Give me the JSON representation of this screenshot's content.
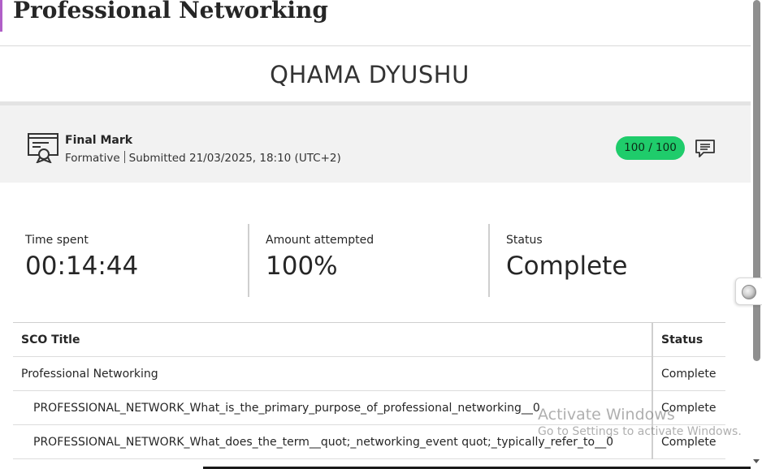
{
  "page": {
    "title": "Professional Networking",
    "accent_color": "#b05fc7"
  },
  "student": {
    "name": "QHAMA DYUSHU"
  },
  "final_mark": {
    "icon": "certificate-icon",
    "label": "Final Mark",
    "type": "Formative",
    "submitted": "Submitted 21/03/2025, 18:10 (UTC+2)",
    "score": "100 / 100",
    "score_color": "#1fcc6b",
    "feedback_icon": "comment-icon"
  },
  "stats": [
    {
      "label": "Time spent",
      "value": "00:14:44"
    },
    {
      "label": "Amount attempted",
      "value": "100%"
    },
    {
      "label": "Status",
      "value": "Complete"
    }
  ],
  "sco_table": {
    "headers": [
      "SCO Title",
      "Status"
    ],
    "rows": [
      {
        "title": "Professional Networking",
        "status": "Complete"
      },
      {
        "title": "PROFESSIONAL_NETWORK_What_is_the_primary_purpose_of_professional_networking__0",
        "status": "Complete"
      },
      {
        "title": "PROFESSIONAL_NETWORK_What_does_the_term__quot;_networking_event quot;_typically_refer_to__0",
        "status": "Complete"
      }
    ]
  },
  "watermark": {
    "title": "Activate Windows",
    "subtitle": "Go to Settings to activate Windows."
  }
}
